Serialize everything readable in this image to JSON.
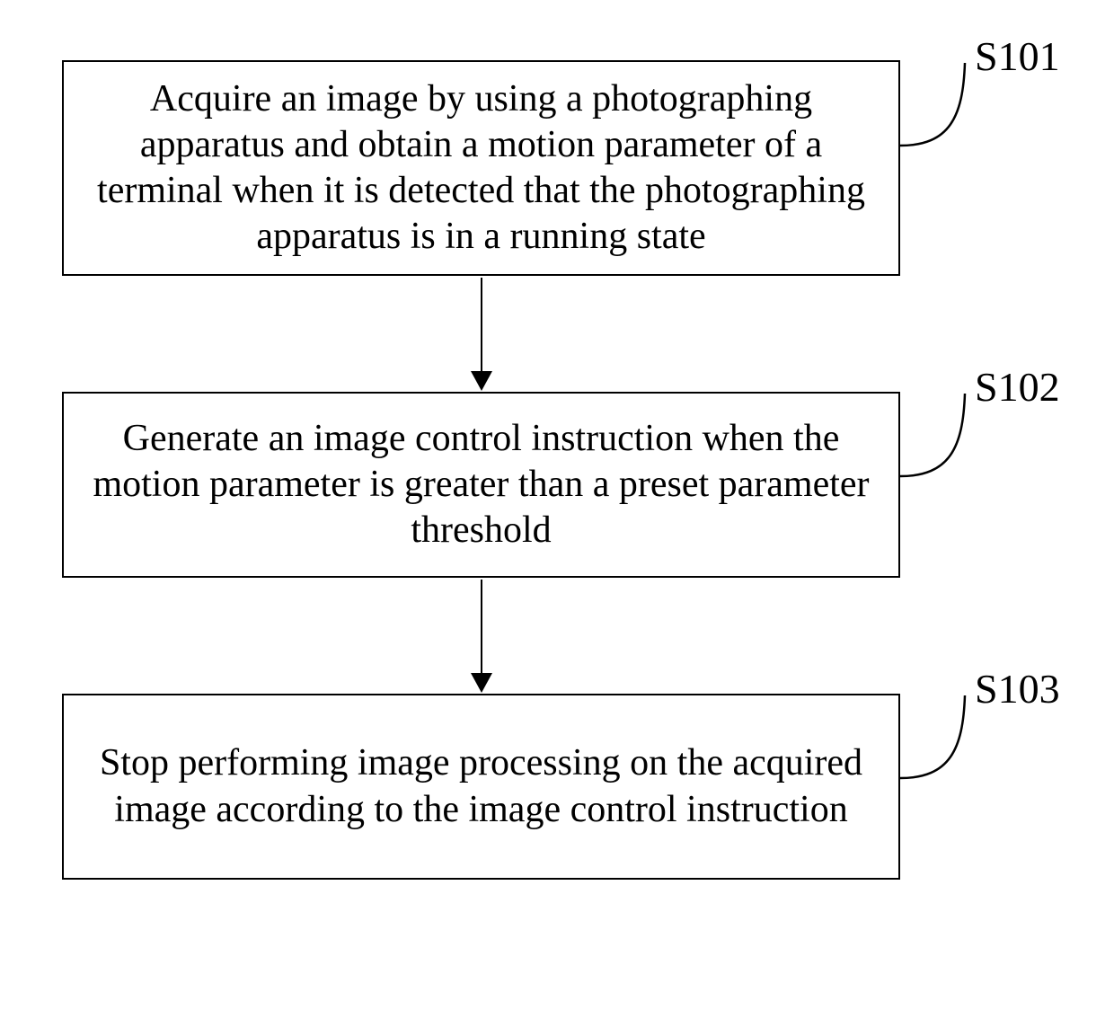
{
  "steps": [
    {
      "id": "S101",
      "text": "Acquire an image by using a photographing apparatus and obtain a motion parameter of a terminal when it is detected that the photographing apparatus is in a running state"
    },
    {
      "id": "S102",
      "text": "Generate an image control instruction when the motion parameter is greater than a preset parameter threshold"
    },
    {
      "id": "S103",
      "text": "Stop performing image processing on the acquired image according to the image control instruction"
    }
  ]
}
